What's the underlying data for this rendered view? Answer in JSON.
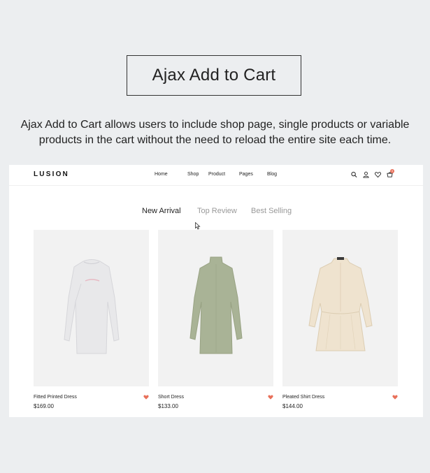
{
  "title": "Ajax Add to Cart",
  "description": "Ajax Add to Cart allows users to include shop page, single products or variable products in the cart without the need to reload the entire site each time.",
  "shop": {
    "logo": "LUSION",
    "nav": [
      "Home",
      "Shop",
      "Product",
      "Pages",
      "Blog"
    ],
    "icons": [
      "search-icon",
      "user-icon",
      "heart-icon",
      "cart-icon"
    ],
    "cart_count": "0",
    "tabs": [
      "New Arrival",
      "Top Review",
      "Best Selling"
    ],
    "active_tab": "New Arrival",
    "products": [
      {
        "name": "Fitted Printed Dress",
        "price": "$169.00",
        "color": "#e8e8ea"
      },
      {
        "name": "Short Dress",
        "price": "$133.00",
        "color": "#a9b396"
      },
      {
        "name": "Pleated Shirt Dress",
        "price": "$144.00",
        "color": "#efe3cf"
      }
    ],
    "accent": "#e8705a"
  }
}
